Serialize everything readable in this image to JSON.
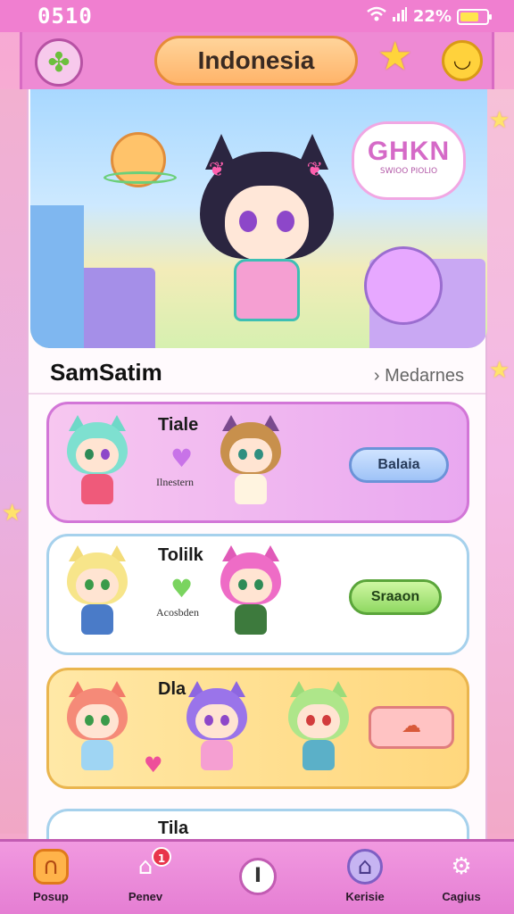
{
  "status_bar": {
    "time": "0510",
    "battery_text": "22%",
    "battery_level": 0.7
  },
  "header": {
    "title": "Indonesia"
  },
  "banner": {
    "logo_big": "GHKN",
    "logo_small": "SWIOO PIOLIO"
  },
  "section": {
    "title": "SamSatim",
    "link": "Medarnes"
  },
  "cards": [
    {
      "title": "Tiale",
      "subtitle": "Ilnestern",
      "button": "Balaia",
      "heart_color": "#c873e8"
    },
    {
      "title": "Tolilk",
      "subtitle": "Acosbden",
      "button": "Sraaon",
      "heart_color": "#7ad45f"
    },
    {
      "title": "Dla"
    },
    {
      "title": "Tila"
    }
  ],
  "tab_bar": {
    "tabs": [
      {
        "label": "Posup"
      },
      {
        "label": "Penev",
        "badge": "1"
      },
      {
        "label": ""
      },
      {
        "label": "Kerisie"
      },
      {
        "label": "Cagius"
      }
    ],
    "center": "I"
  },
  "colors": {
    "accent_pink": "#f07fd0",
    "title_pill": "#ffb46a",
    "card_purple": "#e9a8f0",
    "card_yellow": "#ffd77d",
    "button_blue": "#9fc3f7",
    "button_green": "#8fd862"
  }
}
